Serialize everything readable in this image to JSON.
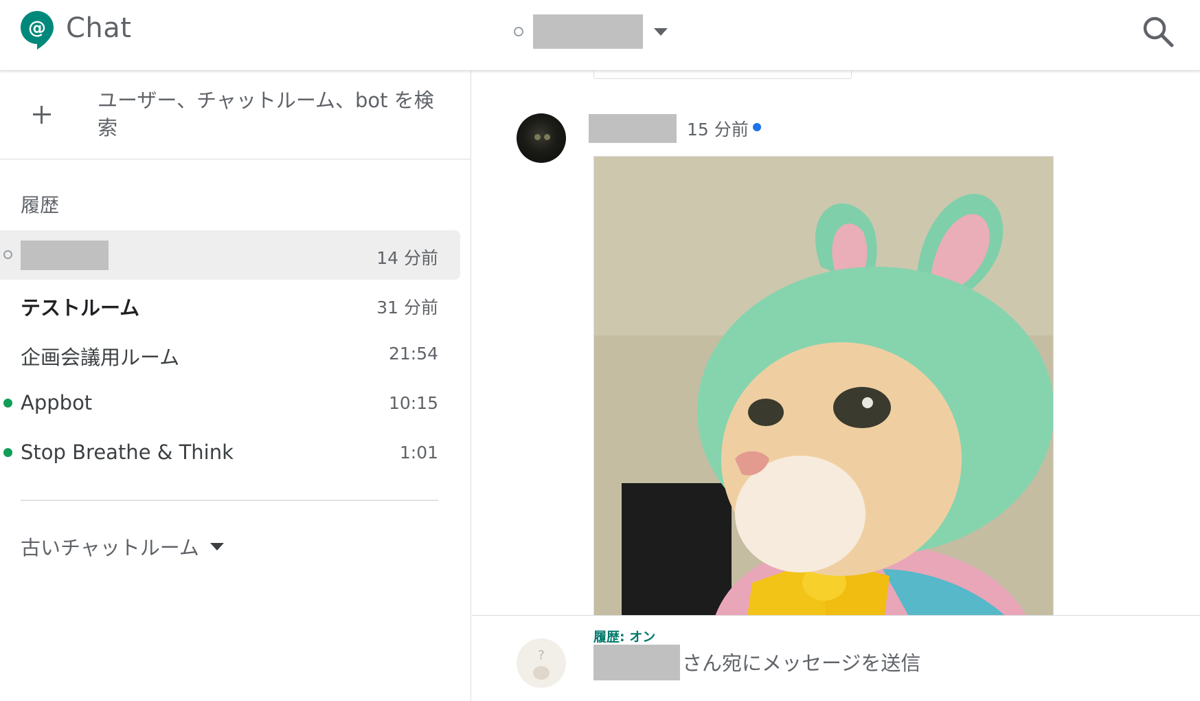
{
  "app": {
    "title": "Chat",
    "accent": "#00897b"
  },
  "header": {
    "search_icon": "search-icon",
    "caret_icon": "caret-down-icon"
  },
  "sidebar": {
    "find_label": "ユーザー、チャットルーム、bot を検索",
    "history_title": "履歴",
    "conversations": [
      {
        "name": "",
        "time": "14 分前",
        "status": "offline",
        "active": true
      },
      {
        "name": "テストルーム",
        "time": "31 分前",
        "bold": true
      },
      {
        "name": "企画会議用ルーム",
        "time": "21:54"
      },
      {
        "name": "Appbot",
        "time": "10:15",
        "status": "online"
      },
      {
        "name": "Stop Breathe & Think",
        "time": "1:01",
        "status": "online"
      }
    ],
    "older_rooms": "古いチャットルーム"
  },
  "message": {
    "time": "15 分前"
  },
  "composer": {
    "history_status": "履歴: オン",
    "placeholder": "さん宛にメッセージを送信"
  }
}
